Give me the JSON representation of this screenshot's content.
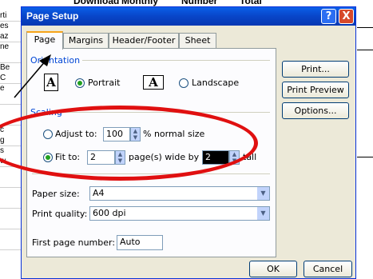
{
  "background": {
    "columns": [
      "Download",
      "Monthly",
      "Number",
      "Total"
    ],
    "row_fragments": [
      "rti",
      "es",
      "az",
      "ne",
      "Be",
      "C",
      "e",
      "c",
      "g",
      "s",
      "w"
    ]
  },
  "dialog": {
    "title": "Page Setup",
    "help_glyph": "?",
    "close_glyph": "X",
    "tabs": [
      {
        "label": "Page",
        "active": true
      },
      {
        "label": "Margins",
        "active": false
      },
      {
        "label": "Header/Footer",
        "active": false
      },
      {
        "label": "Sheet",
        "active": false
      }
    ],
    "orientation": {
      "label": "Orientation",
      "icon_letter": "A",
      "portrait_label": "Portrait",
      "landscape_label": "Landscape",
      "selected": "portrait"
    },
    "scaling": {
      "label": "Scaling",
      "adjust_label": "Adjust to:",
      "adjust_value": "100",
      "adjust_suffix": "% normal size",
      "fit_label": "Fit to:",
      "fit_wide_value": "2",
      "fit_wide_suffix": "page(s) wide by",
      "fit_tall_value": "2",
      "fit_tall_suffix": "tall",
      "selected": "fit"
    },
    "paper_size": {
      "label": "Paper size:",
      "value": "A4"
    },
    "print_quality": {
      "label": "Print quality:",
      "value": "600 dpi"
    },
    "first_page": {
      "label": "First page number:",
      "value": "Auto"
    },
    "buttons": {
      "print": "Print...",
      "preview": "Print Preview",
      "options": "Options...",
      "ok": "OK",
      "cancel": "Cancel"
    }
  },
  "annotation_color": "#e01010"
}
